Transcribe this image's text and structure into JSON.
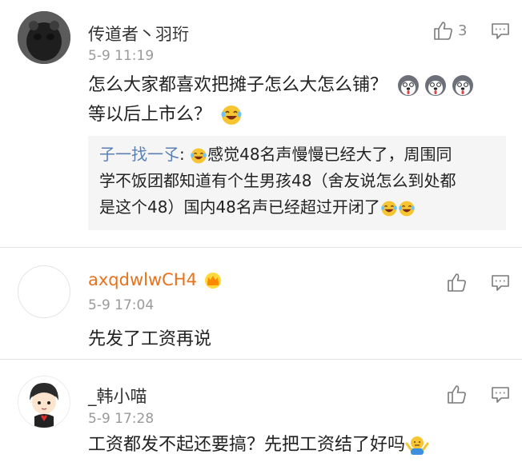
{
  "comments": [
    {
      "username": "传道者丶羽珩",
      "time": "5-9 11:19",
      "like_count": "3",
      "text_line1": "怎么大家都喜欢把摊子怎么大怎么铺？",
      "text_line2": "等以后上市么？",
      "reply": {
        "author": "子一找一孓",
        "sep": ":",
        "line1": "感觉48名声慢慢已经大了，周围同",
        "line2": "学不饭团都知道有个生男孩48（舍友说怎么到处都",
        "line3": "是这个48）国内48名声已经超过开闭了"
      }
    },
    {
      "username": "axqdwlwCH4",
      "time": "5-9 17:04",
      "text": "先发了工资再说"
    },
    {
      "username": "_韩小喵",
      "time": "5-9 17:28",
      "text": "工资都发不起还要搞？先把工资结了好吗"
    }
  ],
  "icons": [
    "thumbs-up-icon",
    "comment-icon",
    "crown-badge-icon",
    "husky-emoji",
    "laugh-cry-emoji",
    "shrug-emoji"
  ],
  "colors": {
    "reply_author": "#5b7fb3",
    "username_vip": "#e8721c",
    "time": "#9a9a9a"
  }
}
